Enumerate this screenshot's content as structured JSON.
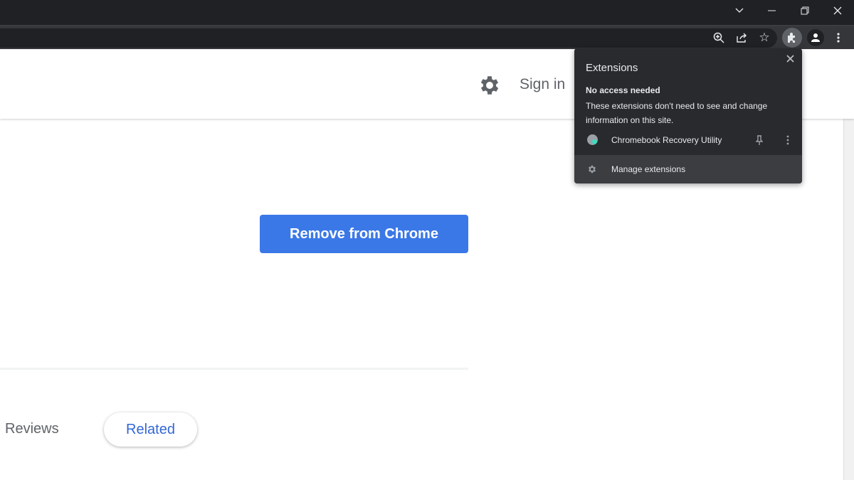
{
  "window": {
    "controls": [
      "tab-search",
      "minimize",
      "restore",
      "close"
    ]
  },
  "toolbar": {
    "icons": [
      "zoom-icon",
      "share-icon",
      "star-icon",
      "extensions-icon",
      "profile-icon",
      "menu-icon"
    ]
  },
  "header": {
    "sign_in": "Sign in"
  },
  "main": {
    "remove_button": "Remove from Chrome",
    "tabs": [
      {
        "label": "Reviews"
      },
      {
        "label": "Related",
        "selected": true
      }
    ]
  },
  "extensions_popup": {
    "title": "Extensions",
    "section_title": "No access needed",
    "section_desc": "These extensions don't need to see and change information on this site.",
    "items": [
      {
        "name": "Chromebook Recovery Utility"
      }
    ],
    "manage": "Manage extensions"
  },
  "colors": {
    "accent": "#3b78e7",
    "related": "#3367d6",
    "popup_bg": "#292a2d"
  }
}
